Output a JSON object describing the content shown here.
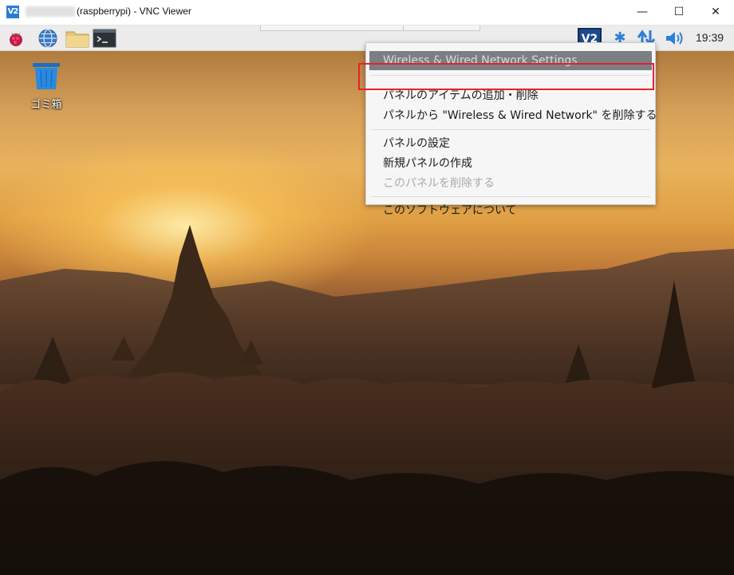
{
  "window": {
    "logo_text": "V2",
    "title": "(raspberrypi) - VNC Viewer",
    "minimize": "—",
    "maximize": "☐",
    "close": "✕"
  },
  "panel": {
    "icons": [
      "raspberry-menu-icon",
      "web-browser-icon",
      "file-manager-icon",
      "terminal-icon"
    ],
    "vnc_tray_label": "V2",
    "bluetooth_glyph": "✱",
    "clock": "19:39"
  },
  "desktop": {
    "trash_label": "ゴミ箱"
  },
  "context_menu": {
    "items": [
      {
        "label": "Wireless & Wired Network Settings",
        "state": "highlighted"
      },
      {
        "label": "パネルのアイテムの追加・削除",
        "state": "normal"
      },
      {
        "label": "パネルから \"Wireless & Wired Network\" を削除する",
        "state": "normal"
      },
      {
        "label": "パネルの設定",
        "state": "normal"
      },
      {
        "label": "新規パネルの作成",
        "state": "normal"
      },
      {
        "label": "このパネルを削除する",
        "state": "disabled"
      },
      {
        "label": "このソフトウェアについて",
        "state": "normal"
      }
    ]
  },
  "colors": {
    "highlight_outline": "#e8202a",
    "menu_highlight": "#7b7f83",
    "tray_accent": "#2f7ed8"
  }
}
